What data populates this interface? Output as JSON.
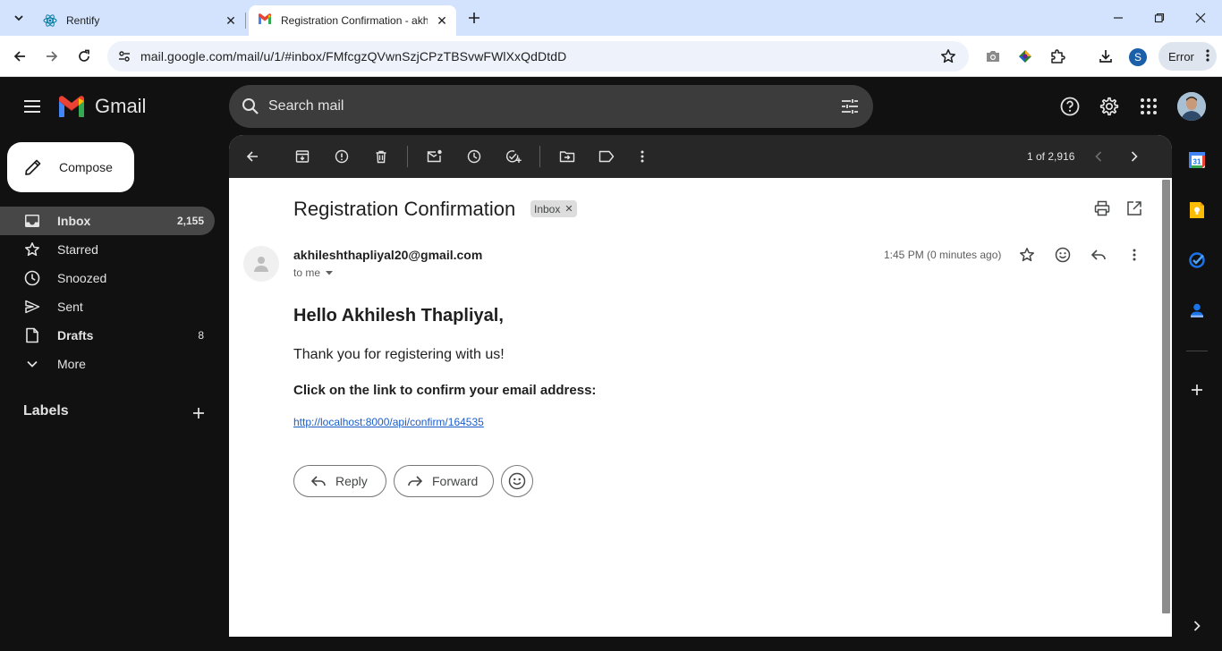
{
  "browser": {
    "tabs": [
      {
        "title": "Rentify",
        "active": false,
        "icon": "react-icon"
      },
      {
        "title": "Registration Confirmation - akh",
        "active": true,
        "icon": "gmail-icon"
      }
    ],
    "url": "mail.google.com/mail/u/1/#inbox/FMfcgzQVwnSzjCPzTBSvwFWlXxQdDtdD",
    "profile_initial": "S",
    "error_label": "Error"
  },
  "gmail": {
    "app_name": "Gmail",
    "search_placeholder": "Search mail",
    "compose_label": "Compose",
    "nav": [
      {
        "label": "Inbox",
        "count": "2,155",
        "icon": "inbox-icon",
        "selected": true
      },
      {
        "label": "Starred",
        "count": "",
        "icon": "star-icon",
        "selected": false
      },
      {
        "label": "Snoozed",
        "count": "",
        "icon": "clock-icon",
        "selected": false
      },
      {
        "label": "Sent",
        "count": "",
        "icon": "send-icon",
        "selected": false
      },
      {
        "label": "Drafts",
        "count": "8",
        "icon": "draft-icon",
        "selected": false
      },
      {
        "label": "More",
        "count": "",
        "icon": "chevron-down-icon",
        "selected": false
      }
    ],
    "labels_title": "Labels",
    "pager": "1 of 2,916"
  },
  "email": {
    "subject": "Registration Confirmation",
    "label_chip": "Inbox",
    "sender": "akhileshthapliyal20@gmail.com",
    "recipient": "to me",
    "time": "1:45 PM (0 minutes ago)",
    "greeting": "Hello Akhilesh Thapliyal,",
    "thanks": "Thank you for registering with us!",
    "instruction": "Click on the link to confirm your email address:",
    "link": "http://localhost:8000/api/confirm/164535",
    "reply_label": "Reply",
    "forward_label": "Forward"
  },
  "colors": {
    "background": "#111111",
    "search_bg": "#3c3c3c",
    "selected_nav": "#474747",
    "link": "#1a5dc9",
    "tabbar": "#d3e3fd"
  }
}
